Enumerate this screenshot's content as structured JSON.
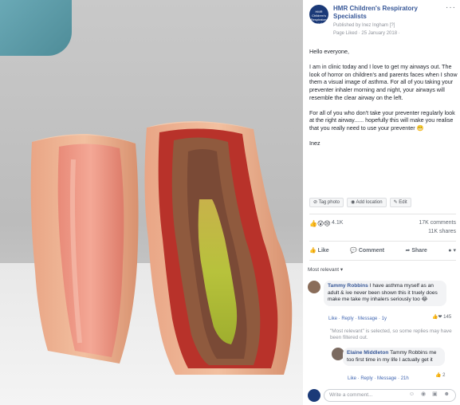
{
  "post": {
    "page_name": "HMR Children's Respiratory Specialists",
    "published_by": "Published by Inez Ingham [?]",
    "date_line": "Page Liked · 25 January 2018 ·",
    "more": "···",
    "avatar_text": "HMR Children's Respiratory Specialists",
    "paragraphs": [
      "Hello everyone,",
      "I am in clinic today and I love to get my airways out. The look of horror on children's and parents faces when I show them a visual image of asthma. For all of you taking your preventer inhaler morning and night, your airways will resemble the clear airway on the left.",
      "For all of you who don't take your preventer regularly look at the right airway...... hopefully this will make you realise that you really need to use your preventer 😬",
      "Inez"
    ]
  },
  "toolbar": {
    "tag_photo": "Tag photo",
    "add_location": "Add location",
    "edit": "Edit"
  },
  "reactions": {
    "icons": "👍😮😢",
    "count": "4.1K",
    "comments": "17K comments",
    "shares": "11K shares"
  },
  "buttons": {
    "like": "Like",
    "comment": "Comment",
    "share": "Share"
  },
  "sort_label": "Most relevant ▾",
  "comments": [
    {
      "name": "Tammy Robbins",
      "text": "I have asthma myself as an adult & ive never been shown this it truely does make me take my inhalers seriously too 😂",
      "actions": "Like · Reply · Message · 1y",
      "reaction_count": "145"
    },
    {
      "name": "Elaine Middleton",
      "text": "Tammy Robbins me too first time in my life I actually get it",
      "actions": "Like · Reply · Message · 21h",
      "reaction_count": "2"
    }
  ],
  "filter_note": "\"Most relevant\" is selected, so some replies may have been filtered out.",
  "write_comment": {
    "placeholder": "Write a comment...",
    "icons": "☺ ◉ ▣ ☻"
  }
}
